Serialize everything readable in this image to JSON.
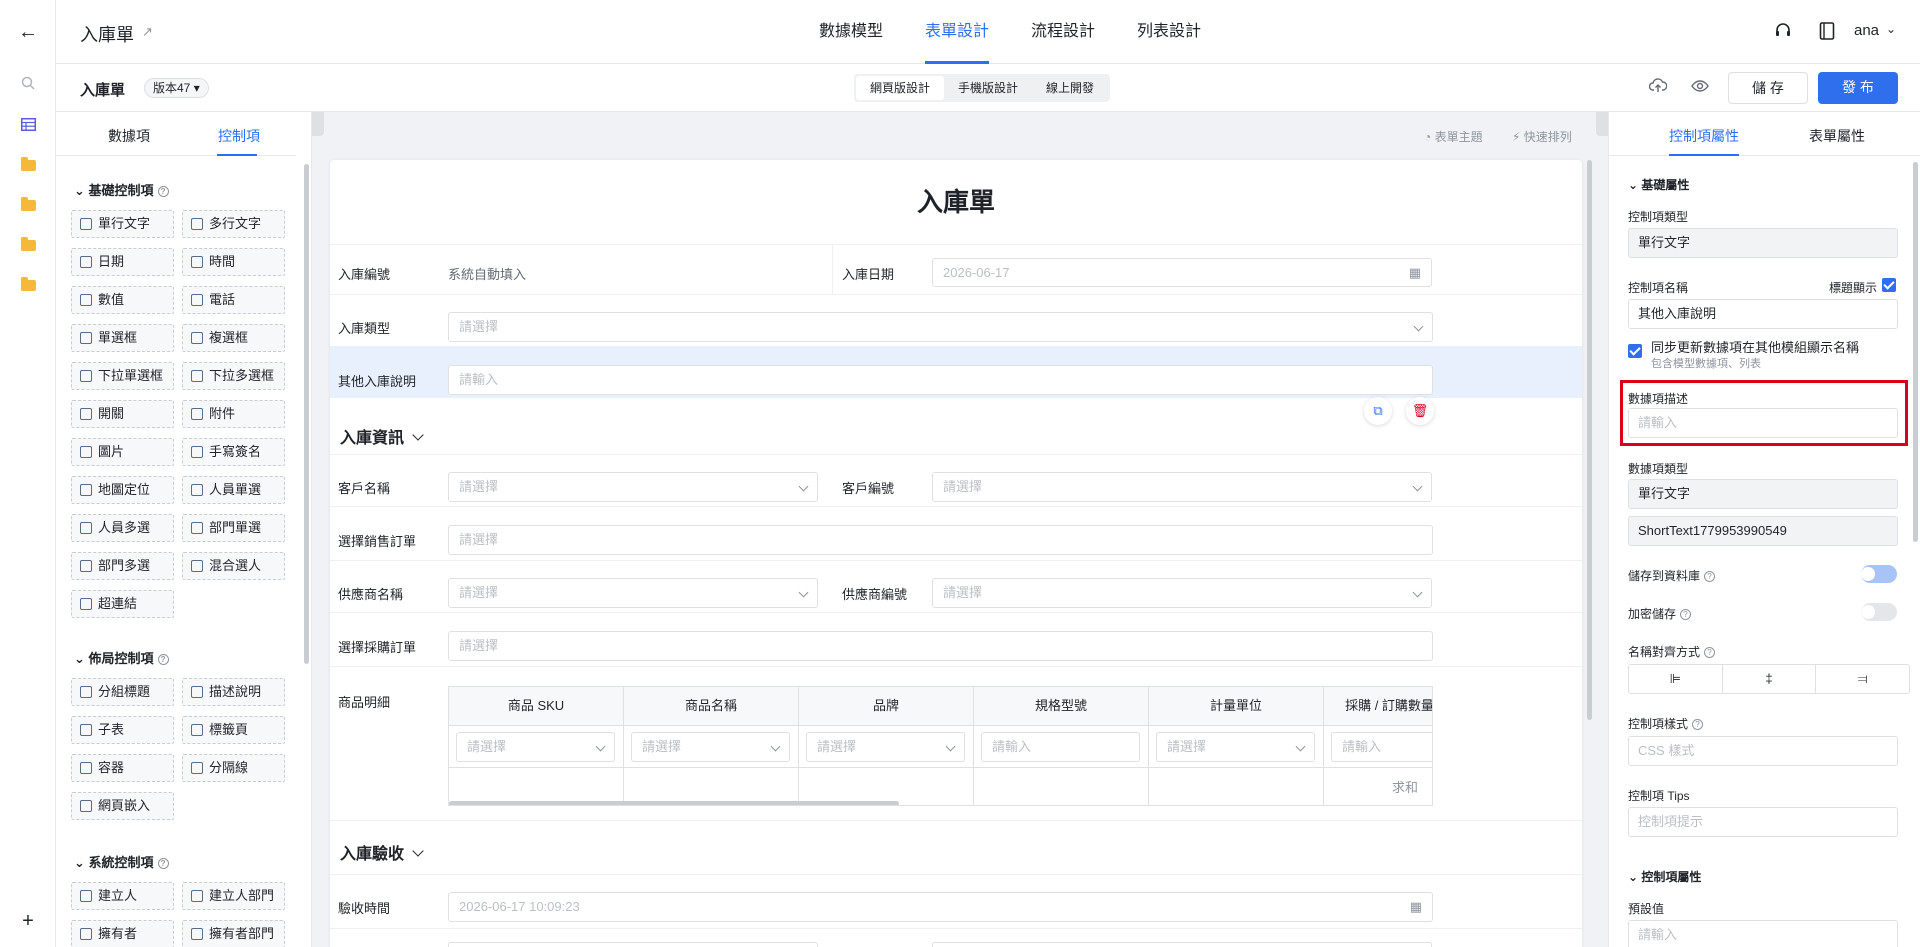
{
  "header": {
    "title": "入庫單",
    "tabs": [
      "數據模型",
      "表單設計",
      "流程設計",
      "列表設計"
    ],
    "active_tab": 1,
    "user": "ana"
  },
  "toolbar": {
    "form_name": "入庫單",
    "version": "版本47",
    "modes": [
      "網頁版設計",
      "手機版設計",
      "線上開發"
    ],
    "save": "儲 存",
    "publish": "發 布"
  },
  "palette": {
    "tabs": [
      "數據項",
      "控制項"
    ],
    "basic_title": "基礎控制項",
    "basic": [
      "單行文字",
      "多行文字",
      "日期",
      "時間",
      "數值",
      "電話",
      "單選框",
      "複選框",
      "下拉單選框",
      "下拉多選框",
      "開關",
      "附件",
      "圖片",
      "手寫簽名",
      "地圖定位",
      "人員單選",
      "人員多選",
      "部門單選",
      "部門多選",
      "混合選人",
      "超連結"
    ],
    "layout_title": "佈局控制項",
    "layout": [
      "分組標題",
      "描述說明",
      "子表",
      "標籤頁",
      "容器",
      "分隔線",
      "網頁嵌入"
    ],
    "system_title": "系統控制項",
    "system": [
      "建立人",
      "建立人部門",
      "擁有者",
      "擁有者部門"
    ]
  },
  "canvas": {
    "theme": "表單主題",
    "arrange": "快速排列",
    "form_title": "入庫單",
    "f_no": "入庫編號",
    "f_no_val": "系統自動填入",
    "f_date": "入庫日期",
    "f_date_val": "2026-06-17",
    "f_type": "入庫類型",
    "f_other": "其他入庫說明",
    "g1": "入庫資訊",
    "f_cust": "客戶名稱",
    "f_custno": "客戶編號",
    "f_so": "選擇銷售訂單",
    "f_sup": "供應商名稱",
    "f_supno": "供應商編號",
    "f_po": "選擇採購訂單",
    "f_items": "商品明細",
    "cols": [
      "商品 SKU",
      "商品名稱",
      "品牌",
      "規格型號",
      "計量單位",
      "採購 / 訂購數量"
    ],
    "sum": "求和",
    "g2": "入庫驗收",
    "f_check": "驗收時間",
    "f_check_val": "2026-06-17 10:09:23",
    "ph_select": "請選擇",
    "ph_input": "請輸入"
  },
  "props": {
    "tabs": [
      "控制項屬性",
      "表單屬性"
    ],
    "basic": "基礎屬性",
    "ctype_l": "控制項類型",
    "ctype": "單行文字",
    "cname_l": "控制項名稱",
    "show_title": "標題顯示",
    "cname": "其他入庫說明",
    "sync": "同步更新數據項在其他模組顯示名稱",
    "sync_sub": "包含模型數據項、列表",
    "desc_l": "數據項描述",
    "desc_ph": "請輸入",
    "dtype_l": "數據項類型",
    "dtype": "單行文字",
    "field_id": "ShortText1779953990549",
    "store": "儲存到資料庫",
    "encrypt": "加密儲存",
    "align": "名稱對齊方式",
    "style_l": "控制項樣式",
    "style_ph": "CSS 樣式",
    "tips_l": "控制項 Tips",
    "tips_ph": "控制項提示",
    "ctrl_props": "控制項屬性",
    "default_l": "預設值",
    "default_ph": "請輸入"
  },
  "colors": {
    "accent": "#2f6fed",
    "highlight_border": "#d9001b"
  }
}
